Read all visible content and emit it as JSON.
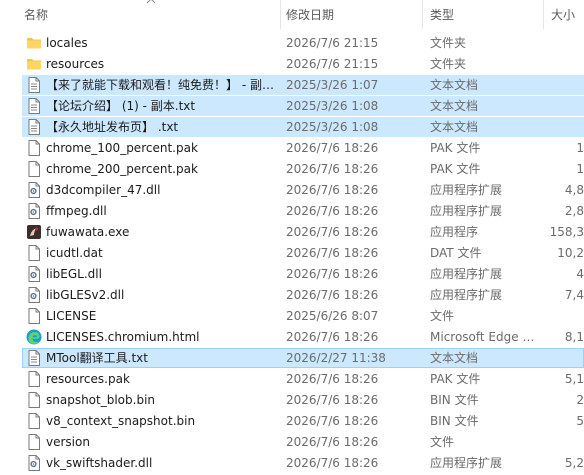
{
  "columns": {
    "name": "名称",
    "date": "修改日期",
    "type": "类型",
    "size": "大小"
  },
  "files": [
    {
      "name": "locales",
      "date": "2026/7/6 21:15",
      "type": "文件夹",
      "size": "",
      "icon": "folder-icon",
      "selected": false
    },
    {
      "name": "resources",
      "date": "2026/7/6 21:15",
      "type": "文件夹",
      "size": "",
      "icon": "folder-icon",
      "selected": false
    },
    {
      "name": "【来了就能下载和观看！纯免费！】 - 副…",
      "date": "2025/3/26 1:07",
      "type": "文本文档",
      "size": "",
      "icon": "text-file-icon",
      "selected": true
    },
    {
      "name": "【论坛介绍】 (1) - 副本.txt",
      "date": "2025/3/26 1:08",
      "type": "文本文档",
      "size": "",
      "icon": "text-file-icon",
      "selected": true
    },
    {
      "name": "【永久地址发布页】 .txt",
      "date": "2025/3/26 1:08",
      "type": "文本文档",
      "size": "",
      "icon": "text-file-icon",
      "selected": true
    },
    {
      "name": "chrome_100_percent.pak",
      "date": "2026/7/6 18:26",
      "type": "PAK 文件",
      "size": "1",
      "icon": "file-icon",
      "selected": false
    },
    {
      "name": "chrome_200_percent.pak",
      "date": "2026/7/6 18:26",
      "type": "PAK 文件",
      "size": "1",
      "icon": "file-icon",
      "selected": false
    },
    {
      "name": "d3dcompiler_47.dll",
      "date": "2026/7/6 18:26",
      "type": "应用程序扩展",
      "size": "4,8",
      "icon": "dll-file-icon",
      "selected": false
    },
    {
      "name": "ffmpeg.dll",
      "date": "2026/7/6 18:26",
      "type": "应用程序扩展",
      "size": "2,8",
      "icon": "dll-file-icon",
      "selected": false
    },
    {
      "name": "fuwawata.exe",
      "date": "2026/7/6 18:26",
      "type": "应用程序",
      "size": "158,3",
      "icon": "app-exe-icon",
      "selected": false
    },
    {
      "name": "icudtl.dat",
      "date": "2026/7/6 18:26",
      "type": "DAT 文件",
      "size": "10,2",
      "icon": "file-icon",
      "selected": false
    },
    {
      "name": "libEGL.dll",
      "date": "2026/7/6 18:26",
      "type": "应用程序扩展",
      "size": "4",
      "icon": "dll-file-icon",
      "selected": false
    },
    {
      "name": "libGLESv2.dll",
      "date": "2026/7/6 18:26",
      "type": "应用程序扩展",
      "size": "7,4",
      "icon": "dll-file-icon",
      "selected": false
    },
    {
      "name": "LICENSE",
      "date": "2025/6/26 8:07",
      "type": "文件",
      "size": "",
      "icon": "file-icon",
      "selected": false
    },
    {
      "name": "LICENSES.chromium.html",
      "date": "2026/7/6 18:26",
      "type": "Microsoft Edge …",
      "size": "8,1",
      "icon": "edge-html-icon",
      "selected": false
    },
    {
      "name": "MTool翻译工具.txt",
      "date": "2026/2/27 11:38",
      "type": "文本文档",
      "size": "",
      "icon": "text-file-icon",
      "selected": "focus"
    },
    {
      "name": "resources.pak",
      "date": "2026/7/6 18:26",
      "type": "PAK 文件",
      "size": "5,1",
      "icon": "file-icon",
      "selected": false
    },
    {
      "name": "snapshot_blob.bin",
      "date": "2026/7/6 18:26",
      "type": "BIN 文件",
      "size": "2",
      "icon": "file-icon",
      "selected": false
    },
    {
      "name": "v8_context_snapshot.bin",
      "date": "2026/7/6 18:26",
      "type": "BIN 文件",
      "size": "5",
      "icon": "file-icon",
      "selected": false
    },
    {
      "name": "version",
      "date": "2026/7/6 18:26",
      "type": "文件",
      "size": "",
      "icon": "file-icon",
      "selected": false
    },
    {
      "name": "vk_swiftshader.dll",
      "date": "2026/7/6 18:26",
      "type": "应用程序扩展",
      "size": "5,2",
      "icon": "dll-file-icon",
      "selected": false
    }
  ],
  "colors": {
    "selection": "#cce8ff",
    "folder": "#f8c448",
    "edge": "#1a9bd7"
  }
}
